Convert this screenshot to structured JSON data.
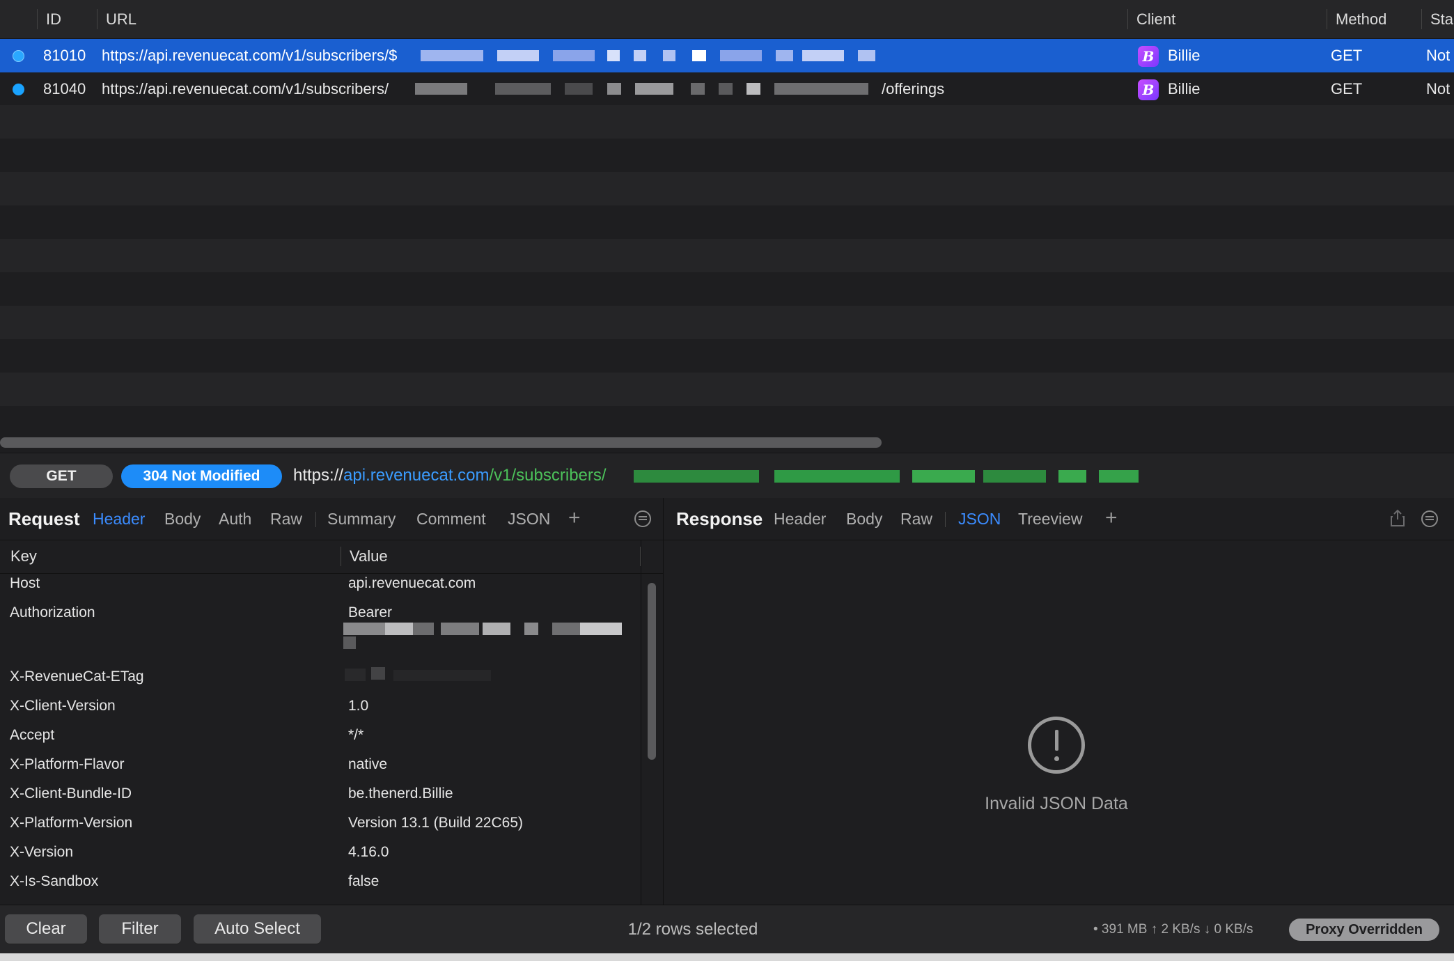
{
  "list": {
    "columns": {
      "id": "ID",
      "url": "URL",
      "client": "Client",
      "method": "Method",
      "status": "Sta"
    },
    "rows": [
      {
        "id": "81010",
        "url_prefix": "https://api.revenuecat.com/v1/subscribers/$",
        "url_suffix": "",
        "client": "Billie",
        "client_icon": "B",
        "method": "GET",
        "status": "Not",
        "selected": true
      },
      {
        "id": "81040",
        "url_prefix": "https://api.revenuecat.com/v1/subscribers/",
        "url_suffix": "/offerings",
        "client": "Billie",
        "client_icon": "B",
        "method": "GET",
        "status": "Not",
        "selected": false
      }
    ]
  },
  "urlbar": {
    "method": "GET",
    "status": "304 Not Modified",
    "scheme": "https://",
    "host": "api.revenuecat.com",
    "path": "/v1/subscribers/"
  },
  "request": {
    "title": "Request",
    "tabs": [
      "Header",
      "Body",
      "Auth",
      "Raw",
      "Summary",
      "Comment",
      "JSON"
    ],
    "active_tab": "Header",
    "key_header": "Key",
    "value_header": "Value",
    "headers": [
      {
        "key": "Host",
        "value": "api.revenuecat.com"
      },
      {
        "key": "Authorization",
        "value": "Bearer"
      },
      {
        "key": "X-RevenueCat-ETag",
        "value": ""
      },
      {
        "key": "X-Client-Version",
        "value": "1.0"
      },
      {
        "key": "Accept",
        "value": "*/*"
      },
      {
        "key": "X-Platform-Flavor",
        "value": "native"
      },
      {
        "key": "X-Client-Bundle-ID",
        "value": "be.thenerd.Billie"
      },
      {
        "key": "X-Platform-Version",
        "value": "Version 13.1 (Build 22C65)"
      },
      {
        "key": "X-Version",
        "value": "4.16.0"
      },
      {
        "key": "X-Is-Sandbox",
        "value": "false"
      }
    ]
  },
  "response": {
    "title": "Response",
    "tabs": [
      "Header",
      "Body",
      "Raw",
      "JSON",
      "Treeview"
    ],
    "active_tab": "JSON",
    "empty_message": "Invalid JSON Data"
  },
  "bottom": {
    "clear": "Clear",
    "filter": "Filter",
    "auto_select": "Auto Select",
    "rows_selected": "1/2 rows selected",
    "stats": "• 391 MB ↑ 2 KB/s ↓ 0 KB/s",
    "proxy": "Proxy Overridden"
  },
  "colors": {
    "accent": "#1d8cf8",
    "selection": "#1a5fd0",
    "url_host": "#3b9cff",
    "url_path": "#4cc25a"
  }
}
